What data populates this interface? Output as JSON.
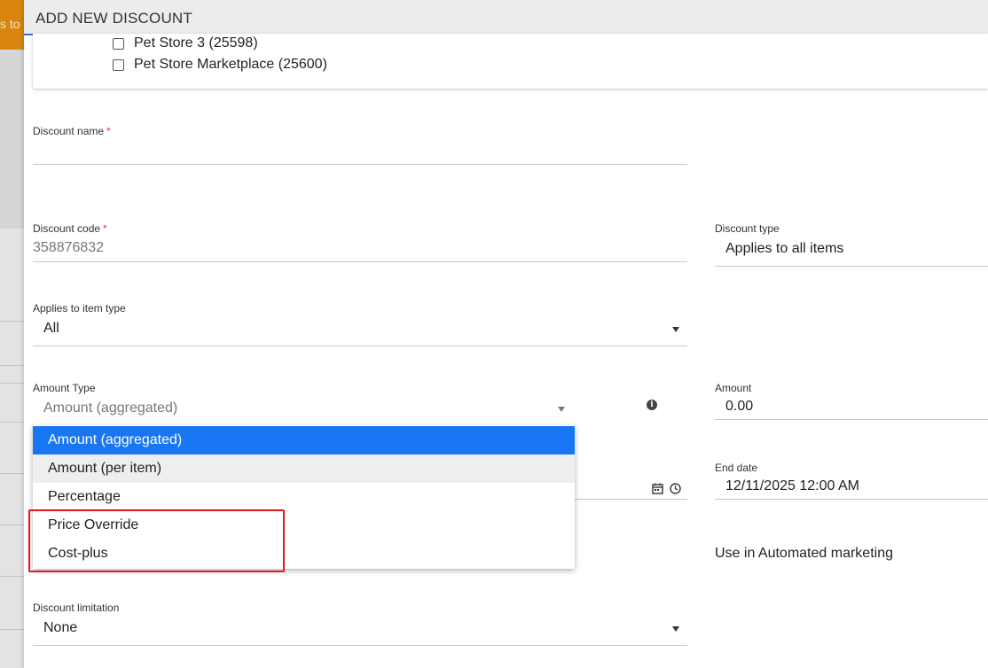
{
  "background": {
    "banner_text": "s to"
  },
  "dialog": {
    "title": "ADD NEW DISCOUNT"
  },
  "stores": [
    {
      "label": "Pet Store 3 (25598)",
      "checked": false
    },
    {
      "label": "Pet Store Marketplace (25600)",
      "checked": false
    }
  ],
  "form": {
    "discount_name": {
      "label": "Discount name",
      "value": ""
    },
    "discount_code": {
      "label": "Discount code",
      "value": "358876832"
    },
    "discount_type": {
      "label": "Discount type",
      "value": "Applies to all items"
    },
    "applies_to_item_type": {
      "label": "Applies to item type",
      "value": "All"
    },
    "amount_type": {
      "label": "Amount Type",
      "value": "Amount (aggregated)"
    },
    "amount": {
      "label": "Amount",
      "value": "0.00"
    },
    "end_date": {
      "label": "End date",
      "value": "12/11/2025 12:00 AM"
    },
    "automated_marketing": {
      "label": "Use in Automated marketing"
    },
    "discount_limitation": {
      "label": "Discount limitation",
      "value": "None"
    }
  },
  "amount_type_menu": {
    "options": [
      "Amount (aggregated)",
      "Amount (per item)",
      "Percentage",
      "Price Override",
      "Cost-plus"
    ],
    "selected": "Amount (aggregated)",
    "hovered": "Amount (per item)"
  },
  "colors": {
    "accent": "#1976f2",
    "header_border": "#2f6fd6",
    "highlight": "#e01919",
    "required": "#e53935",
    "banner": "#d8860f"
  }
}
